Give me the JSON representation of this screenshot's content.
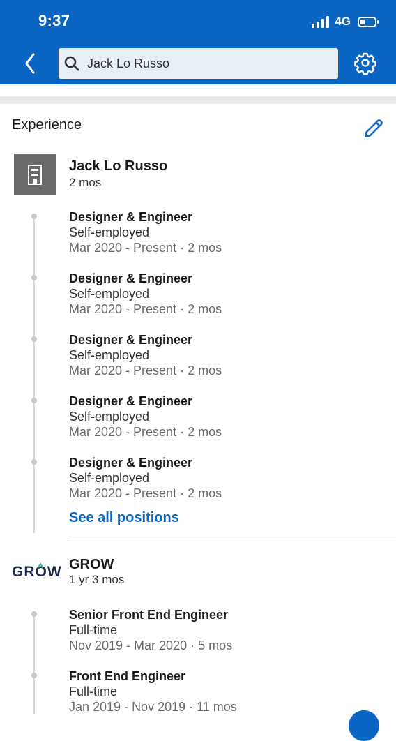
{
  "status_bar": {
    "time": "9:37",
    "network": "4G"
  },
  "header": {
    "search_value": "Jack Lo Russo"
  },
  "experience": {
    "title": "Experience",
    "companies": [
      {
        "name": "Jack Lo Russo",
        "duration": "2 mos",
        "positions": [
          {
            "title": "Designer & Engineer",
            "type": "Self-employed",
            "dates": "Mar 2020 - Present · 2 mos"
          },
          {
            "title": "Designer & Engineer",
            "type": "Self-employed",
            "dates": "Mar 2020 - Present · 2 mos"
          },
          {
            "title": "Designer & Engineer",
            "type": "Self-employed",
            "dates": "Mar 2020 - Present · 2 mos"
          },
          {
            "title": "Designer & Engineer",
            "type": "Self-employed",
            "dates": "Mar 2020 - Present · 2 mos"
          },
          {
            "title": "Designer & Engineer",
            "type": "Self-employed",
            "dates": "Mar 2020 - Present · 2 mos"
          }
        ],
        "see_all_label": "See all positions"
      },
      {
        "name": "GROW",
        "logo_text": "GROW",
        "duration": "1 yr 3 mos",
        "positions": [
          {
            "title": "Senior Front End Engineer",
            "type": "Full-time",
            "dates": "Nov 2019 - Mar 2020 · 5 mos"
          },
          {
            "title": "Front End Engineer",
            "type": "Full-time",
            "dates": "Jan 2019 - Nov 2019 · 11 mos"
          }
        ]
      }
    ]
  },
  "colors": {
    "brand": "#0a66c2",
    "page_bg": "#ffffff",
    "muted_text": "#6b6b6b"
  },
  "icons": [
    "back-chevron-icon",
    "search-icon",
    "gear-icon",
    "pencil-icon",
    "building-icon"
  ]
}
